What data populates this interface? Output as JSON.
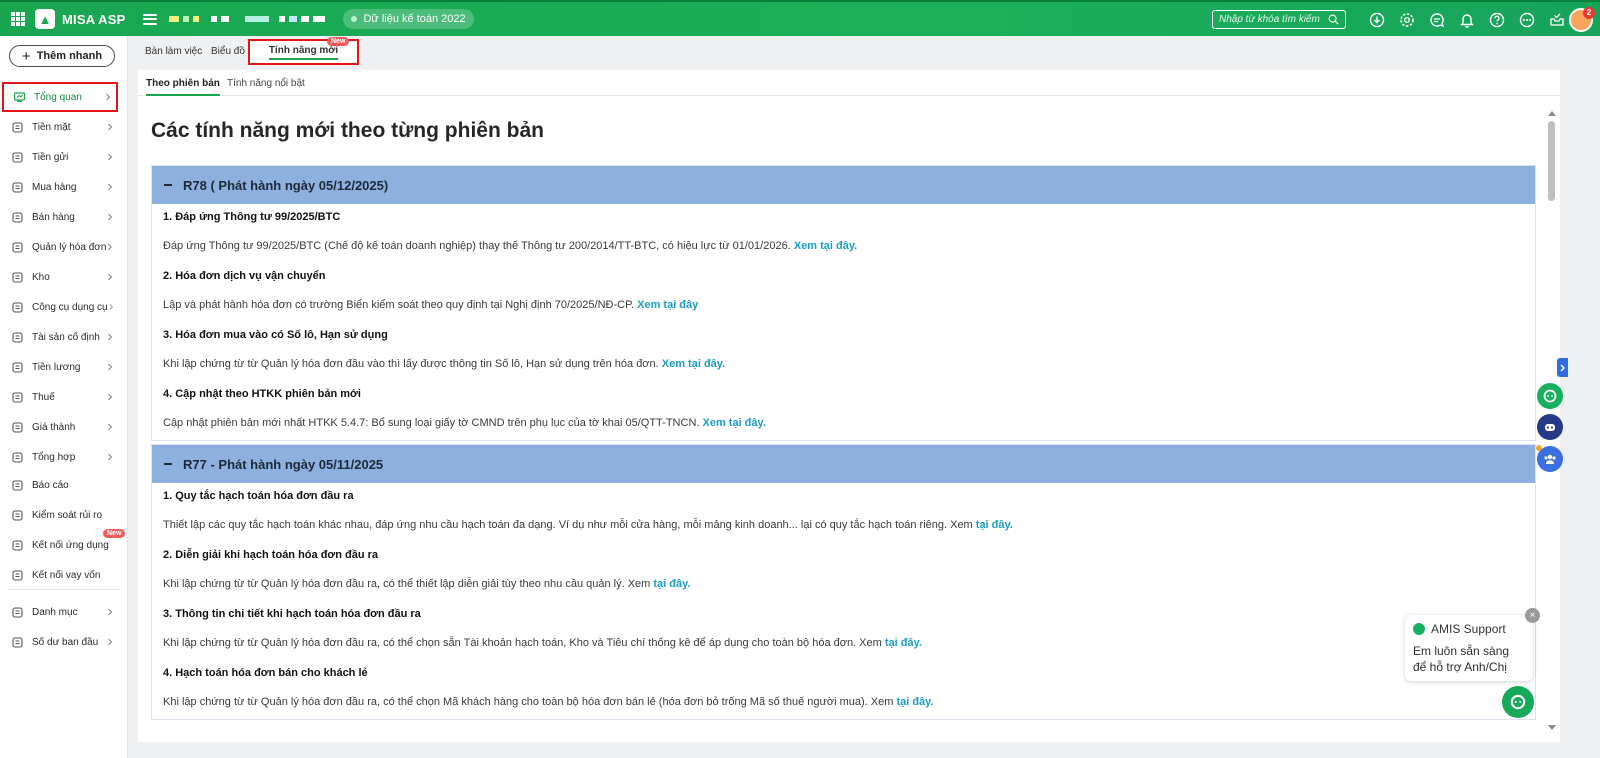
{
  "app": {
    "name": "MISA ASP",
    "data_pill": "Dữ liệu kế toán 2022"
  },
  "search": {
    "placeholder": "Nhập từ khóa tìm kiếm"
  },
  "notifications": {
    "count": "2"
  },
  "sidebar": {
    "quick_add": "Thêm nhanh",
    "items": [
      {
        "label": "Tổng quan",
        "icon": "dashboard-icon",
        "chevron": true
      },
      {
        "label": "Tiền mặt",
        "icon": "money-bag-icon",
        "chevron": true
      },
      {
        "label": "Tiền gửi",
        "icon": "bank-icon",
        "chevron": true
      },
      {
        "label": "Mua hàng",
        "icon": "shopping-bag-icon",
        "chevron": true
      },
      {
        "label": "Bán hàng",
        "icon": "cart-icon",
        "chevron": true
      },
      {
        "label": "Quản lý hóa đơn",
        "icon": "invoice-icon",
        "chevron": true
      },
      {
        "label": "Kho",
        "icon": "warehouse-icon",
        "chevron": true
      },
      {
        "label": "Công cụ dụng cụ",
        "icon": "tools-icon",
        "chevron": true
      },
      {
        "label": "Tài sản cố định",
        "icon": "asset-icon",
        "chevron": true
      },
      {
        "label": "Tiền lương",
        "icon": "payroll-icon",
        "chevron": true
      },
      {
        "label": "Thuế",
        "icon": "tax-icon",
        "chevron": true
      },
      {
        "label": "Giá thành",
        "icon": "price-tag-icon",
        "chevron": true
      },
      {
        "label": "Tổng hợp",
        "icon": "summary-icon",
        "chevron": true
      },
      {
        "label": "Báo cáo",
        "icon": "report-icon",
        "chevron": false
      },
      {
        "label": "Kiểm soát rủi ro",
        "icon": "risk-icon",
        "chevron": false
      },
      {
        "label": "Kết nối ứng dụng",
        "icon": "plug-icon",
        "chevron": false,
        "badge": "New"
      },
      {
        "label": "Kết nối vay vốn",
        "icon": "loan-icon",
        "chevron": false
      },
      {
        "label": "Danh mục",
        "icon": "catalog-icon",
        "chevron": true
      },
      {
        "label": "Số dư ban đầu",
        "icon": "balance-icon",
        "chevron": true
      }
    ]
  },
  "tabs": {
    "items": [
      "Bàn làm việc",
      "Biểu đồ",
      "Tính năng mới"
    ],
    "new_badge": "New"
  },
  "subtabs": [
    "Theo phiên bản",
    "Tính năng nổi bật"
  ],
  "page": {
    "title": "Các tính năng mới theo từng phiên bản",
    "releases": [
      {
        "title": "R78 ( Phát hành ngày 05/12/2025)",
        "features": [
          {
            "title": "1. Đáp ứng Thông tư 99/2025/BTC",
            "desc": "Đáp ứng Thông tư 99/2025/BTC (Chế độ kế toán doanh nghiệp) thay thế Thông tư 200/2014/TT-BTC, có hiệu lực từ 01/01/2026. ",
            "link": "Xem tại đây."
          },
          {
            "title": "2. Hóa đơn dịch vụ vận chuyển",
            "desc": "Lập và phát hành hóa đơn có trường Biển kiểm soát theo quy định tại Nghị định 70/2025/NĐ-CP. ",
            "link": "Xem tại đây"
          },
          {
            "title": "3. Hóa đơn mua vào có Số lô, Hạn sử dụng",
            "desc": "Khi lập chứng từ từ Quản lý hóa đơn đầu vào thì lấy được thông tin Số lô, Hạn sử dụng trên hóa đơn. ",
            "link": "Xem tại đây."
          },
          {
            "title": "4. Cập nhật theo HTKK phiên bản mới",
            "desc": "Cập nhật phiên bản mới nhất HTKK 5.4.7: Bổ sung loại giấy tờ CMND trên phụ lục của tờ khai 05/QTT-TNCN. ",
            "link": "Xem tại đây."
          }
        ]
      },
      {
        "title": "R77 - Phát hành ngày 05/11/2025",
        "features": [
          {
            "title": "1. Quy tắc hạch toán hóa đơn đầu ra",
            "desc": "Thiết lập các quy tắc hạch toán khác nhau, đáp ứng nhu cầu hạch toán đa dạng. Ví dụ như mỗi cửa hàng, mỗi mảng kinh doanh... lại có quy tắc hạch toán riêng. Xem ",
            "link": "tại đây."
          },
          {
            "title": "2. Diễn giải khi hạch toán hóa đơn đầu ra",
            "desc": "Khi lập chứng từ từ Quản lý hóa đơn đầu ra, có thể thiết lập diễn giải tùy theo nhu cầu quản lý. Xem ",
            "link": "tại đây."
          },
          {
            "title": "3. Thông tin chi tiết khi hạch toán hóa đơn đầu ra",
            "desc": "Khi lập chứng từ từ Quản lý hóa đơn đầu ra, có thể chọn sẵn Tài khoản hạch toán, Kho và Tiêu chí thống kê để áp dụng cho toàn bộ hóa đơn. Xem ",
            "link": "tại đây."
          },
          {
            "title": "4. Hạch toán hóa đơn bán cho khách lẻ",
            "desc": "Khi lập chứng từ từ Quản lý hóa đơn đầu ra, có thể chọn Mã khách hàng cho toàn bộ hóa đơn bán lẻ (hóa đơn bỏ trống Mã số thuế người mua). Xem ",
            "link": "tại đây."
          }
        ]
      }
    ]
  },
  "support": {
    "title": "AMIS Support",
    "message": "Em luôn sẵn sàng để hỗ trợ Anh/Chị",
    "close": "×"
  },
  "colors": {
    "brand": "#1aa551",
    "release_header": "#8eb0de",
    "link": "#1c9dc5",
    "highlight": "#e4161b"
  }
}
